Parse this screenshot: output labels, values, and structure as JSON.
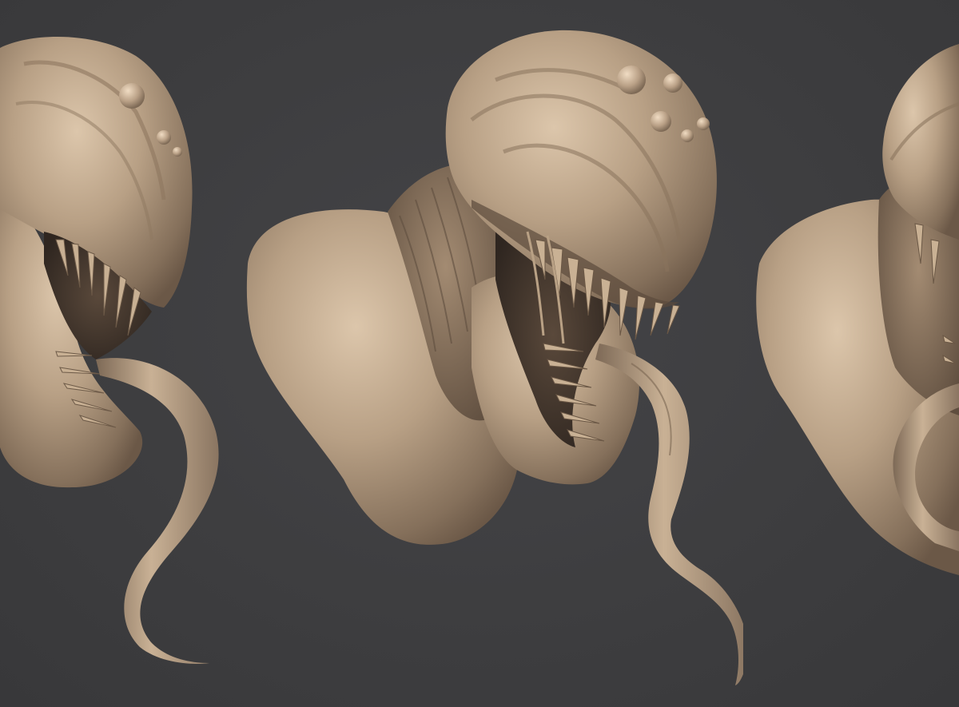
{
  "scene": {
    "background_color": "#3d3d3f",
    "material_color": "#b49a7f",
    "material_highlight": "#d8c1a6",
    "material_shadow": "#6e5a47",
    "views": [
      {
        "id": "left",
        "subject": "creature-bust",
        "view": "three-quarter-left",
        "cropped": true
      },
      {
        "id": "center",
        "subject": "creature-bust",
        "view": "three-quarter-front",
        "cropped": false
      },
      {
        "id": "right",
        "subject": "creature-bust",
        "view": "side",
        "cropped": true
      }
    ]
  }
}
